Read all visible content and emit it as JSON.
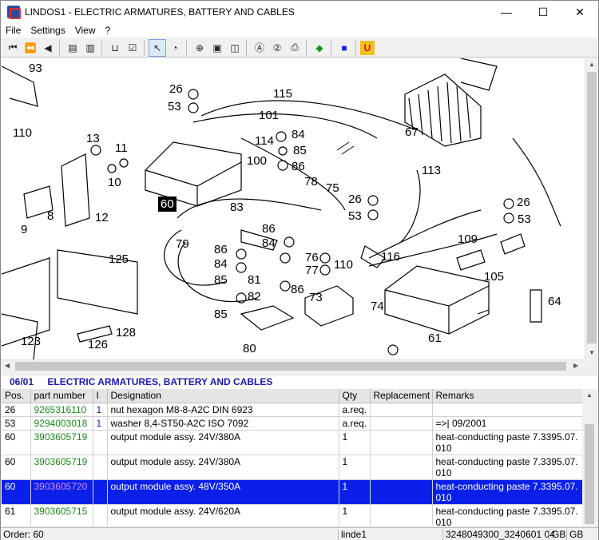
{
  "window": {
    "title": "LINDOS1 - ELECTRIC ARMATURES, BATTERY AND CABLES",
    "minimize": "—",
    "maximize": "☐",
    "close": "✕"
  },
  "menu": [
    "File",
    "Settings",
    "View",
    "?"
  ],
  "drawing": {
    "callouts": [
      "93",
      "110",
      "13",
      "11",
      "10",
      "8",
      "9",
      "12",
      "26",
      "53",
      "115",
      "101",
      "114",
      "100",
      "84",
      "85",
      "86",
      "78",
      "75",
      "83",
      "60",
      "67",
      "113",
      "26",
      "53",
      "26",
      "53",
      "79",
      "86",
      "84",
      "86",
      "84",
      "81",
      "82",
      "85",
      "76",
      "77",
      "110",
      "73",
      "74",
      "116",
      "109",
      "105",
      "64",
      "125",
      "128",
      "126",
      "123",
      "80",
      "85",
      "86",
      "61"
    ],
    "highlighted": "60"
  },
  "parts": {
    "section_number": "06/01",
    "section_title": "ELECTRIC ARMATURES, BATTERY AND CABLES",
    "columns": [
      "Pos.",
      "part number",
      "I",
      "Designation",
      "Qty",
      "Replacement",
      "Remarks"
    ],
    "rows": [
      {
        "pos": "26",
        "part_number": "9265316110",
        "ind": "1",
        "designation": "nut hexagon M8-8-A2C  DIN 6923",
        "qty": "a.req.",
        "replacement": "",
        "remarks": ""
      },
      {
        "pos": "53",
        "part_number": "9294003018",
        "ind": "1",
        "designation": "washer 8,4-ST50-A2C  ISO 7092",
        "qty": "a.req.",
        "replacement": "",
        "remarks": "=>| 09/2001"
      },
      {
        "pos": "60",
        "part_number": "3903605719",
        "ind": "",
        "designation": "output module assy. 24V/380A",
        "qty": "1",
        "replacement": "",
        "remarks": "heat-conducting paste 7.3395.07.\n010"
      },
      {
        "pos": "60",
        "part_number": "3903605719",
        "ind": "",
        "designation": "output module assy. 24V/380A",
        "qty": "1",
        "replacement": "",
        "remarks": "heat-conducting paste 7.3395.07.\n010"
      },
      {
        "pos": "60",
        "part_number": "3903605720",
        "ind": "",
        "designation": "output module assy. 48V/350A",
        "qty": "1",
        "replacement": "",
        "remarks": "heat-conducting paste 7.3395.07.\n010",
        "selected": true
      },
      {
        "pos": "61",
        "part_number": "3903605715",
        "ind": "",
        "designation": "output module assy. 24V/620A",
        "qty": "1",
        "replacement": "",
        "remarks": "heat-conducting paste 7.3395.07.\n010"
      }
    ]
  },
  "status": {
    "order": "Order: 60",
    "user": "linde1",
    "code": "3248049300_3240601 04",
    "lang1": "GB",
    "lang2": "GB"
  },
  "colors": {
    "section_title": "#1a1aa8",
    "part_number": "#1d8a1d",
    "selected_row": "#0a1fe8",
    "selected_part_number": "#d48cf4"
  }
}
